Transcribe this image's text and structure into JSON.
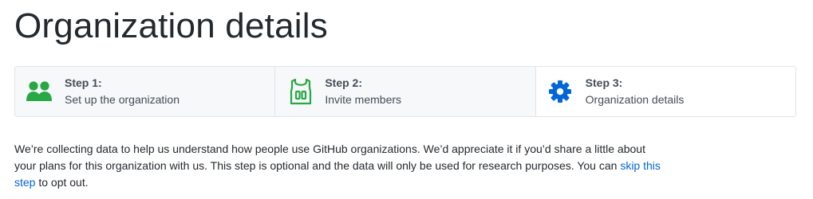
{
  "page_title": "Organization details",
  "steps": [
    {
      "number": "Step 1:",
      "label": "Set up the organization",
      "icon": "people-icon",
      "state": "completed",
      "color": "#28a745"
    },
    {
      "number": "Step 2:",
      "label": "Invite members",
      "icon": "jersey-icon",
      "state": "completed",
      "color": "#28a745"
    },
    {
      "number": "Step 3:",
      "label": "Organization details",
      "icon": "gear-icon",
      "state": "current",
      "color": "#0366d6"
    }
  ],
  "intro": {
    "text_before_link": "We’re collecting data to help us understand how people use GitHub organizations. We’d appreciate it if you’d share a little about your plans for this organization with us. This step is optional and the data will only be used for research purposes. You can ",
    "link_text": "skip this step",
    "text_after_link": " to opt out."
  },
  "colors": {
    "completed": "#28a745",
    "current": "#0366d6",
    "link": "#0366d6"
  }
}
